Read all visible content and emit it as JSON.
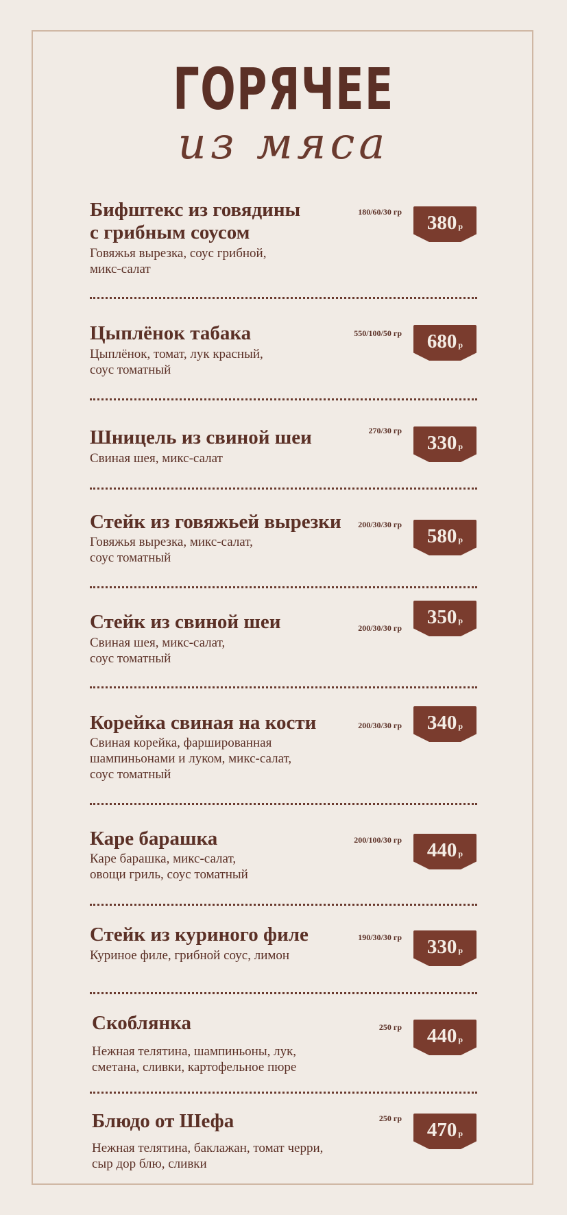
{
  "title": {
    "main": "ГОРЯЧЕЕ",
    "sub": "из мяса"
  },
  "currency": "р",
  "items": [
    {
      "name": "Бифштекс из говядины\nс грибным соусом",
      "desc": "Говяжья вырезка, соус грибной,\nмикс-салат",
      "weight": "180/60/30 гр",
      "price": "380"
    },
    {
      "name": "Цыплёнок табака",
      "desc": "Цыплёнок, томат, лук красный,\nсоус томатный",
      "weight": "550/100/50 гр",
      "price": "680"
    },
    {
      "name": "Шницель из свиной шеи",
      "desc": "Свиная шея, микс-салат",
      "weight": "270/30 гр",
      "price": "330"
    },
    {
      "name": "Стейк из говяжьей вырезки",
      "desc": "Говяжья вырезка, микс-салат,\nсоус томатный",
      "weight": "200/30/30 гр",
      "price": "580"
    },
    {
      "name": "Стейк из свиной шеи",
      "desc": "Свиная шея, микс-салат,\nсоус томатный",
      "weight": "200/30/30 гр",
      "price": "350"
    },
    {
      "name": "Корейка свиная на кости",
      "desc": "Свиная корейка, фаршированная\nшампиньонами и луком, микс-салат,\nсоус томатный",
      "weight": "200/30/30 гр",
      "price": "340"
    },
    {
      "name": "Каре барашка",
      "desc": "Каре барашка, микс-салат,\nовощи гриль, соус томатный",
      "weight": "200/100/30 гр",
      "price": "440"
    },
    {
      "name": "Стейк из куриного филе",
      "desc": "Куриное филе, грибной соус, лимон",
      "weight": "190/30/30 гр",
      "price": "330"
    },
    {
      "name": "Скоблянка",
      "desc": "Нежная телятина, шампиньоны, лук,\nсметана, сливки, картофельное пюре",
      "weight": "250 гр",
      "price": "440"
    },
    {
      "name": "Блюдо от Шефа",
      "desc": "Нежная телятина, баклажан, томат черри,\nсыр дор блю, сливки",
      "weight": "250 гр",
      "price": "470"
    }
  ]
}
